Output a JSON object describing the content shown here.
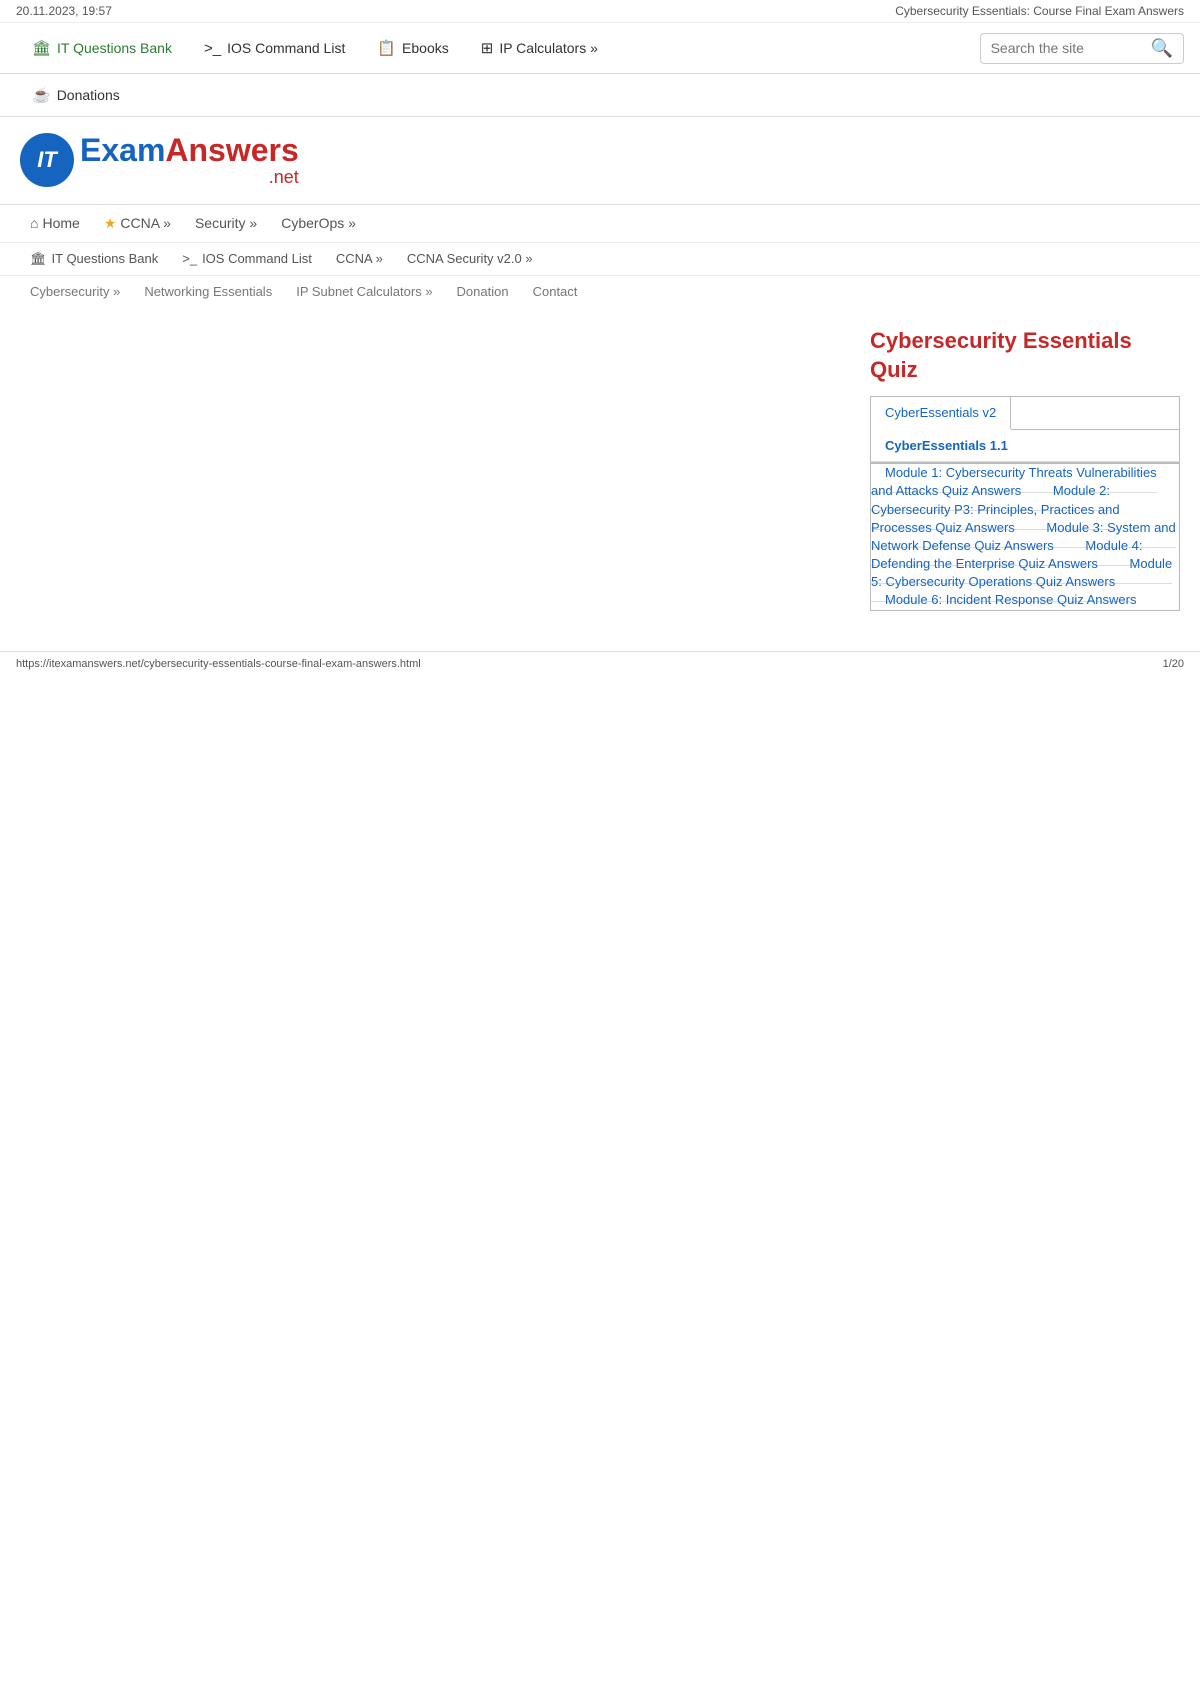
{
  "meta": {
    "timestamp": "20.11.2023, 19:57",
    "page_title": "Cybersecurity Essentials: Course Final Exam Answers",
    "page_number": "1/20",
    "url": "https://itexamanswers.net/cybersecurity-essentials-course-final-exam-answers.html"
  },
  "top_nav": {
    "items": [
      {
        "id": "it-questions-bank",
        "label": "IT Questions Bank",
        "icon": "🏛",
        "class": "green"
      },
      {
        "id": "ios-command-list",
        "label": "IOS Command List",
        "icon": ">_"
      },
      {
        "id": "ebooks",
        "label": "Ebooks",
        "icon": "📋"
      },
      {
        "id": "ip-calculators",
        "label": "IP Calculators »",
        "icon": "⊞"
      }
    ],
    "donations": {
      "label": "Donations",
      "icon": "☕"
    },
    "search": {
      "placeholder": "Search the site"
    }
  },
  "logo": {
    "it_letter": "IT",
    "exam_text": "Exam",
    "answers_text": "Answers",
    "net_text": ".net"
  },
  "main_nav": {
    "items": [
      {
        "id": "home",
        "label": "Home",
        "icon": "⌂"
      },
      {
        "id": "ccna",
        "label": "CCNA »",
        "icon": "★"
      },
      {
        "id": "security",
        "label": "Security »",
        "icon": ""
      },
      {
        "id": "cyberops",
        "label": "CyberOps »",
        "icon": ""
      }
    ]
  },
  "second_nav": {
    "items": [
      {
        "id": "it-questions-bank2",
        "label": "IT Questions Bank",
        "icon": "🏛"
      },
      {
        "id": "ios-command-list2",
        "label": "IOS Command List",
        "icon": ">_"
      },
      {
        "id": "ccna2",
        "label": "CCNA »",
        "icon": ""
      },
      {
        "id": "ccna-security",
        "label": "CCNA Security v2.0 »",
        "icon": ""
      }
    ]
  },
  "third_nav": {
    "items": [
      {
        "id": "cybersecurity",
        "label": "Cybersecurity »"
      },
      {
        "id": "networking-essentials",
        "label": "Networking Essentials"
      },
      {
        "id": "ip-subnet-calculators",
        "label": "IP Subnet Calculators »"
      },
      {
        "id": "donation",
        "label": "Donation"
      },
      {
        "id": "contact",
        "label": "Contact"
      }
    ]
  },
  "sidebar": {
    "title": "Cybersecurity Essentials Quiz",
    "tab_v2_label": "CyberEssentials v2",
    "tab_v11_label": "CyberEssentials 1.1",
    "modules": [
      {
        "id": "module-1",
        "label": "Module 1: Cybersecurity Threats Vulnerabilities and Attacks Quiz Answers"
      },
      {
        "id": "module-2",
        "label": "Module 2: Cybersecurity P3: Principles, Practices and Processes Quiz Answers"
      },
      {
        "id": "module-3",
        "label": "Module 3: System and Network Defense Quiz Answers"
      },
      {
        "id": "module-4",
        "label": "Module 4: Defending the Enterprise Quiz Answers"
      },
      {
        "id": "module-5",
        "label": "Module 5: Cybersecurity Operations Quiz Answers"
      },
      {
        "id": "module-6",
        "label": "Module 6: Incident Response Quiz Answers"
      }
    ]
  }
}
